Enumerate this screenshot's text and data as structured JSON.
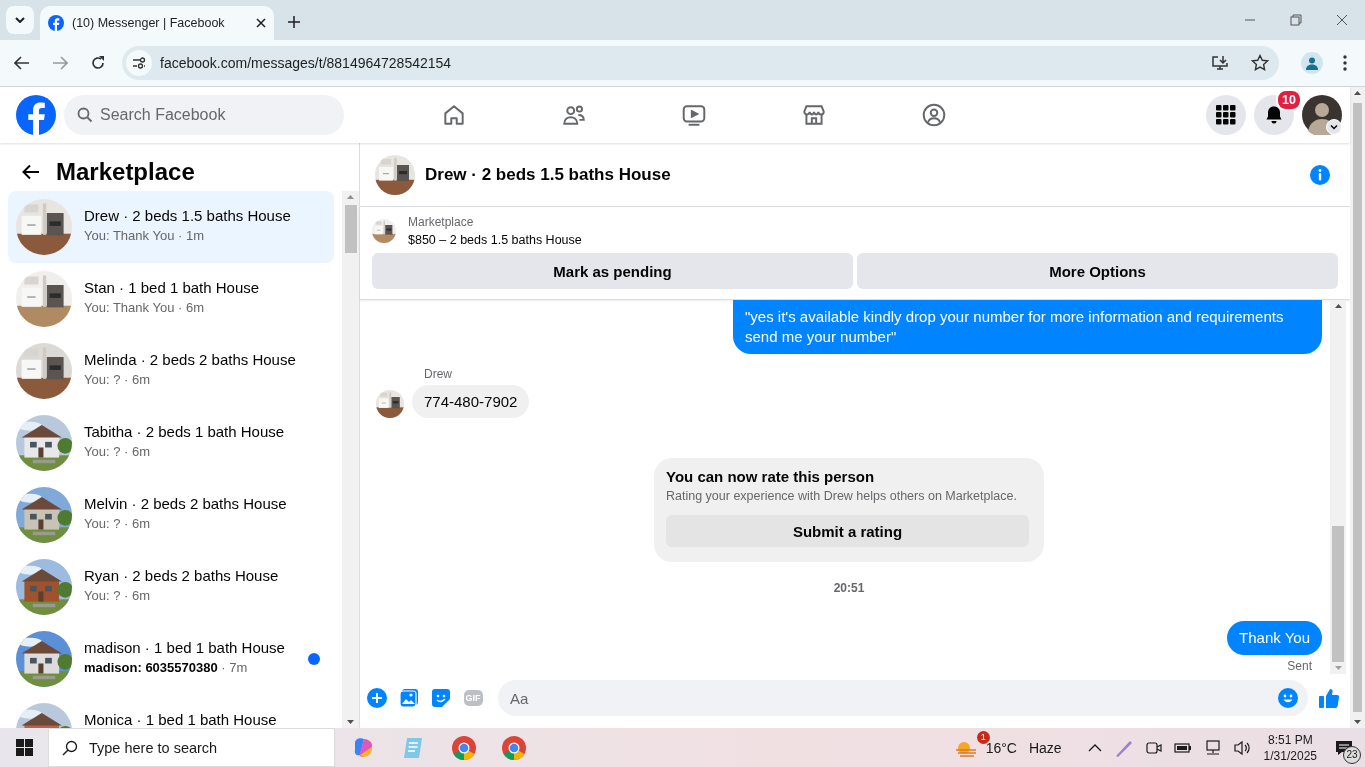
{
  "browser": {
    "tab_title": "(10) Messenger | Facebook",
    "url": "facebook.com/messages/t/8814964728542154"
  },
  "topbar": {
    "search": {
      "placeholder": "Search Facebook"
    },
    "notification_count": "10"
  },
  "sidebar": {
    "title": "Marketplace",
    "conversations": [
      {
        "title": "Drew · 2 beds 1.5 baths House",
        "preview": "You: Thank You · 1m",
        "selected": true,
        "unread": false
      },
      {
        "title": "Stan · 1 bed 1 bath House",
        "preview": "You: Thank You · 6m",
        "selected": false,
        "unread": false
      },
      {
        "title": "Melinda · 2 beds 2 baths House",
        "preview": "You: ? · 6m",
        "selected": false,
        "unread": false
      },
      {
        "title": "Tabitha · 2 beds 1 bath House",
        "preview": "You: ? · 6m",
        "selected": false,
        "unread": false
      },
      {
        "title": "Melvin · 2 beds 2 baths House",
        "preview": "You: ? · 6m",
        "selected": false,
        "unread": false
      },
      {
        "title": "Ryan · 2 beds 2 baths House",
        "preview": "You: ? · 6m",
        "selected": false,
        "unread": false
      },
      {
        "title": "madison · 1 bed 1 bath House",
        "preview": "**madison: 6035570380** · 7m",
        "selected": false,
        "unread": true
      },
      {
        "title": "Monica · 1 bed 1 bath House",
        "selected": false,
        "unread": false
      }
    ]
  },
  "chat": {
    "title": "Drew · 2 beds 1.5 baths House",
    "listing": {
      "label": "Marketplace",
      "summary": "$850 – 2 beds 1.5 baths House"
    },
    "actions": [
      "Mark as pending",
      "More Options"
    ],
    "messages": [
      {
        "kind": "outgoing",
        "text": "\"yes it's available kindly drop your number for more information and requirements send me your number\""
      },
      {
        "kind": "incoming",
        "sender": "Drew",
        "text": "774-480-7902"
      },
      {
        "kind": "rating",
        "title": "You can now rate this person",
        "subtitle": "Rating your experience with Drew helps others on Marketplace.",
        "button": "Submit a rating"
      },
      {
        "kind": "timestamp",
        "text": "20:51"
      },
      {
        "kind": "outgoing",
        "text": "Thank You",
        "status": "Sent"
      }
    ],
    "composer": {
      "placeholder": "Aa",
      "gif_label": "GIF"
    }
  },
  "taskbar": {
    "search_placeholder": "Type here to search",
    "weather": {
      "badge": "1",
      "temperature": "16°C",
      "condition": "Haze"
    },
    "time": "8:51 PM",
    "date": "1/31/2025",
    "notification_count": "23"
  }
}
